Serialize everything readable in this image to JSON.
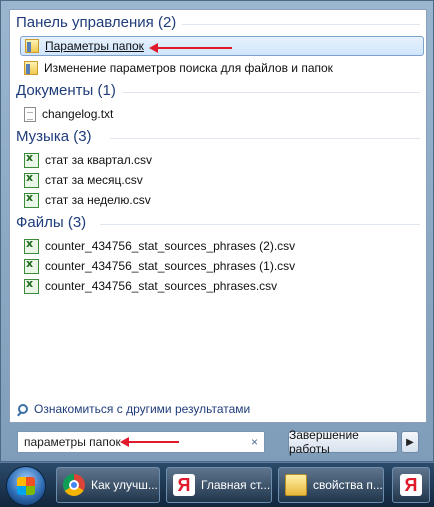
{
  "start_menu": {
    "groups": [
      {
        "header": "Панель управления (2)",
        "items": [
          {
            "label": "Параметры папок",
            "icon": "folder-options-icon",
            "selected": true
          },
          {
            "label": "Изменение параметров поиска для файлов и папок",
            "icon": "folder-options-icon"
          }
        ]
      },
      {
        "header": "Документы (1)",
        "items": [
          {
            "label": "changelog.txt",
            "icon": "text-file-icon"
          }
        ]
      },
      {
        "header": "Музыка (3)",
        "items": [
          {
            "label": "стат за квартал.csv",
            "icon": "csv-file-icon"
          },
          {
            "label": "стат за месяц.csv",
            "icon": "csv-file-icon"
          },
          {
            "label": "стат за неделю.csv",
            "icon": "csv-file-icon"
          }
        ]
      },
      {
        "header": "Файлы (3)",
        "items": [
          {
            "label": "counter_434756_stat_sources_phrases (2).csv",
            "icon": "csv-file-icon"
          },
          {
            "label": "counter_434756_stat_sources_phrases (1).csv",
            "icon": "csv-file-icon"
          },
          {
            "label": "counter_434756_stat_sources_phrases.csv",
            "icon": "csv-file-icon"
          }
        ]
      }
    ],
    "more_results": "Ознакомиться с другими результатами",
    "search": {
      "value": "параметры папок",
      "clear_glyph": "×"
    },
    "shutdown_label": "Завершение работы",
    "shutdown_arrow": "▶"
  },
  "taskbar": {
    "buttons": [
      {
        "label": "Как улучш...",
        "icon": "chrome-icon"
      },
      {
        "label": "Главная ст...",
        "icon": "yandex-icon",
        "icon_glyph": "Я"
      },
      {
        "label": "свойства п...",
        "icon": "folder-icon"
      }
    ],
    "pinned_glyph": "Я"
  },
  "colors": {
    "annotation_arrow": "#e0192b",
    "header_text": "#1f3d7a"
  }
}
